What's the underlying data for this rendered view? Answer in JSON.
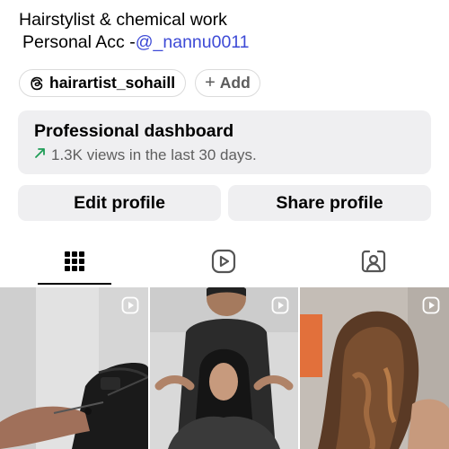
{
  "profile": {
    "bio_line1": "Hairstylist & chemical work",
    "bio_line2_prefix": "Personal Acc -",
    "bio_mention": "@_nannu0011",
    "threads_handle": "hairartist_sohaill",
    "add_label": "Add"
  },
  "dashboard": {
    "title": "Professional dashboard",
    "stats": "1.3K views in the last 30 days."
  },
  "actions": {
    "edit_label": "Edit profile",
    "share_label": "Share profile"
  },
  "tabs": [
    {
      "icon": "grid-icon",
      "active": true
    },
    {
      "icon": "reels-icon",
      "active": false
    },
    {
      "icon": "tagged-icon",
      "active": false
    }
  ],
  "posts": [
    {
      "type": "reel",
      "subject": "hair-extension-application"
    },
    {
      "type": "reel",
      "subject": "wet-hair-treatment"
    },
    {
      "type": "reel",
      "subject": "styled-caramel-waves"
    }
  ],
  "colors": {
    "mention": "#3d4ad6",
    "card_bg": "#efeff1",
    "trend_arrow": "#1f9d57",
    "secondary_text": "#5f5f5f"
  }
}
